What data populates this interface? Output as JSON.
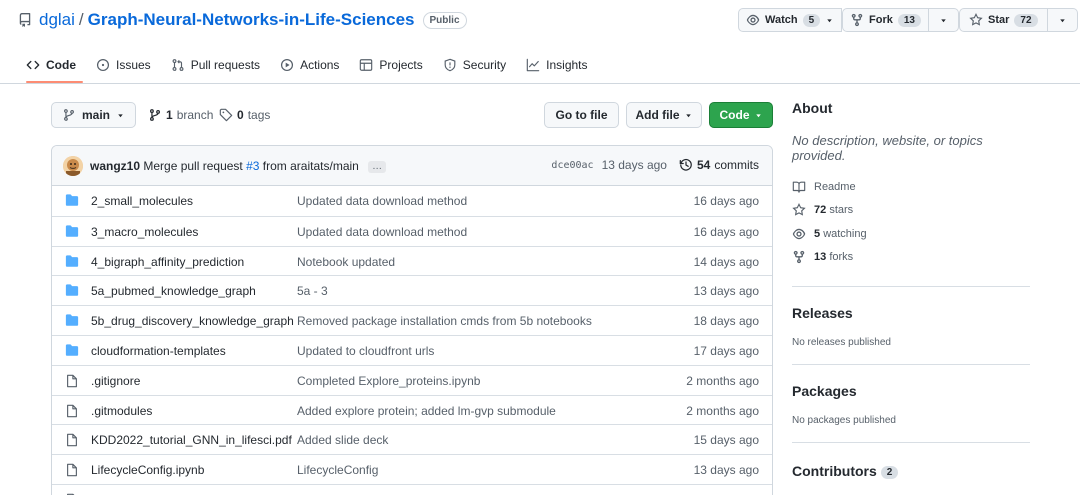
{
  "repo": {
    "owner": "dglai",
    "separator": "/",
    "name": "Graph-Neural-Networks-in-Life-Sciences",
    "visibility": "Public"
  },
  "actions": {
    "watch": {
      "label": "Watch",
      "count": "5"
    },
    "fork": {
      "label": "Fork",
      "count": "13"
    },
    "star": {
      "label": "Star",
      "count": "72"
    }
  },
  "tabs": [
    {
      "label": "Code",
      "icon": "code-icon"
    },
    {
      "label": "Issues",
      "icon": "issue-icon"
    },
    {
      "label": "Pull requests",
      "icon": "pull-request-icon"
    },
    {
      "label": "Actions",
      "icon": "play-icon"
    },
    {
      "label": "Projects",
      "icon": "table-icon"
    },
    {
      "label": "Security",
      "icon": "shield-icon"
    },
    {
      "label": "Insights",
      "icon": "graph-icon"
    }
  ],
  "toolbar": {
    "branch": "main",
    "branches_count": "1",
    "branches_label": "branch",
    "tags_count": "0",
    "tags_label": "tags",
    "goto_file": "Go to file",
    "add_file": "Add file",
    "code": "Code"
  },
  "commit": {
    "author": "wangz10",
    "message_pre": "Merge pull request",
    "pr": "#3",
    "message_post": "from araitats/main",
    "ellipsis": "…",
    "sha": "dce00ac",
    "age": "13 days ago",
    "commits_count": "54",
    "commits_label": "commits"
  },
  "files": [
    {
      "type": "folder",
      "name": "2_small_molecules",
      "message": "Updated data download method",
      "age": "16 days ago"
    },
    {
      "type": "folder",
      "name": "3_macro_molecules",
      "message": "Updated data download method",
      "age": "16 days ago"
    },
    {
      "type": "folder",
      "name": "4_bigraph_affinity_prediction",
      "message": "Notebook updated",
      "age": "14 days ago"
    },
    {
      "type": "folder",
      "name": "5a_pubmed_knowledge_graph",
      "message": "5a - 3",
      "age": "13 days ago"
    },
    {
      "type": "folder",
      "name": "5b_drug_discovery_knowledge_graph",
      "message": "Removed package installation cmds from 5b notebooks",
      "age": "18 days ago"
    },
    {
      "type": "folder",
      "name": "cloudformation-templates",
      "message": "Updated to cloudfront urls",
      "age": "17 days ago"
    },
    {
      "type": "file",
      "name": ".gitignore",
      "message": "Completed Explore_proteins.ipynb",
      "age": "2 months ago"
    },
    {
      "type": "file",
      "name": ".gitmodules",
      "message": "Added explore protein; added lm-gvp submodule",
      "age": "2 months ago"
    },
    {
      "type": "file",
      "name": "KDD2022_tutorial_GNN_in_lifesci.pdf",
      "message": "Added slide deck",
      "age": "15 days ago"
    },
    {
      "type": "file",
      "name": "LifecycleConfig.ipynb",
      "message": "LifecycleConfig",
      "age": "13 days ago"
    },
    {
      "type": "file",
      "name": "",
      "message": "",
      "age": ""
    }
  ],
  "about": {
    "title": "About",
    "description": "No description, website, or topics provided.",
    "readme": "Readme",
    "stars_count": "72",
    "stars_label": "stars",
    "watching_count": "5",
    "watching_label": "watching",
    "forks_count": "13",
    "forks_label": "forks"
  },
  "releases": {
    "title": "Releases",
    "note": "No releases published"
  },
  "packages": {
    "title": "Packages",
    "note": "No packages published"
  },
  "contributors": {
    "title": "Contributors",
    "count": "2"
  },
  "colors": {
    "link": "#0969da",
    "accent_underline": "#fd8c73",
    "code_button": "#2da44e",
    "folder": "#54aeff"
  }
}
